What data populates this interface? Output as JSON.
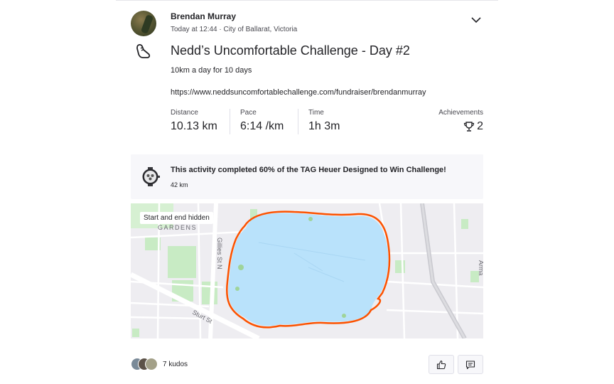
{
  "athlete": {
    "name": "Brendan Murray",
    "meta": "Today at 12:44 · City of Ballarat, Victoria"
  },
  "activity": {
    "sport_icon": "run-shoe-icon",
    "title": "Nedd’s Uncomfortable Challenge - Day #2",
    "description": "10km a day for 10 days",
    "link": "https://www.neddsuncomfortablechallenge.com/fundraiser/brendanmurray"
  },
  "stats": [
    {
      "label": "Distance",
      "value": "10.13 km"
    },
    {
      "label": "Pace",
      "value": "6:14 /km"
    },
    {
      "label": "Time",
      "value": "1h 3m"
    }
  ],
  "achievements": {
    "label": "Achievements",
    "icon": "trophy-icon",
    "value": "2"
  },
  "challenge": {
    "text": "This activity completed 60% of the TAG Heuer Designed to Win Challenge!",
    "sub": "42 km",
    "badge_icon": "watch-badge-icon"
  },
  "map": {
    "label": "Start and end hidden",
    "street_labels": [
      "GARDENS",
      "Gillies St N",
      "Sturt St",
      "Arma"
    ],
    "colors": {
      "route": "#fc5200",
      "water": "#b9e2fb",
      "park": "#c8ebc4",
      "road": "#ffffff"
    }
  },
  "kudos": {
    "count_text": "7 kudos"
  },
  "actions": {
    "kudos_icon": "thumbs-up-icon",
    "comment_icon": "comment-icon"
  }
}
